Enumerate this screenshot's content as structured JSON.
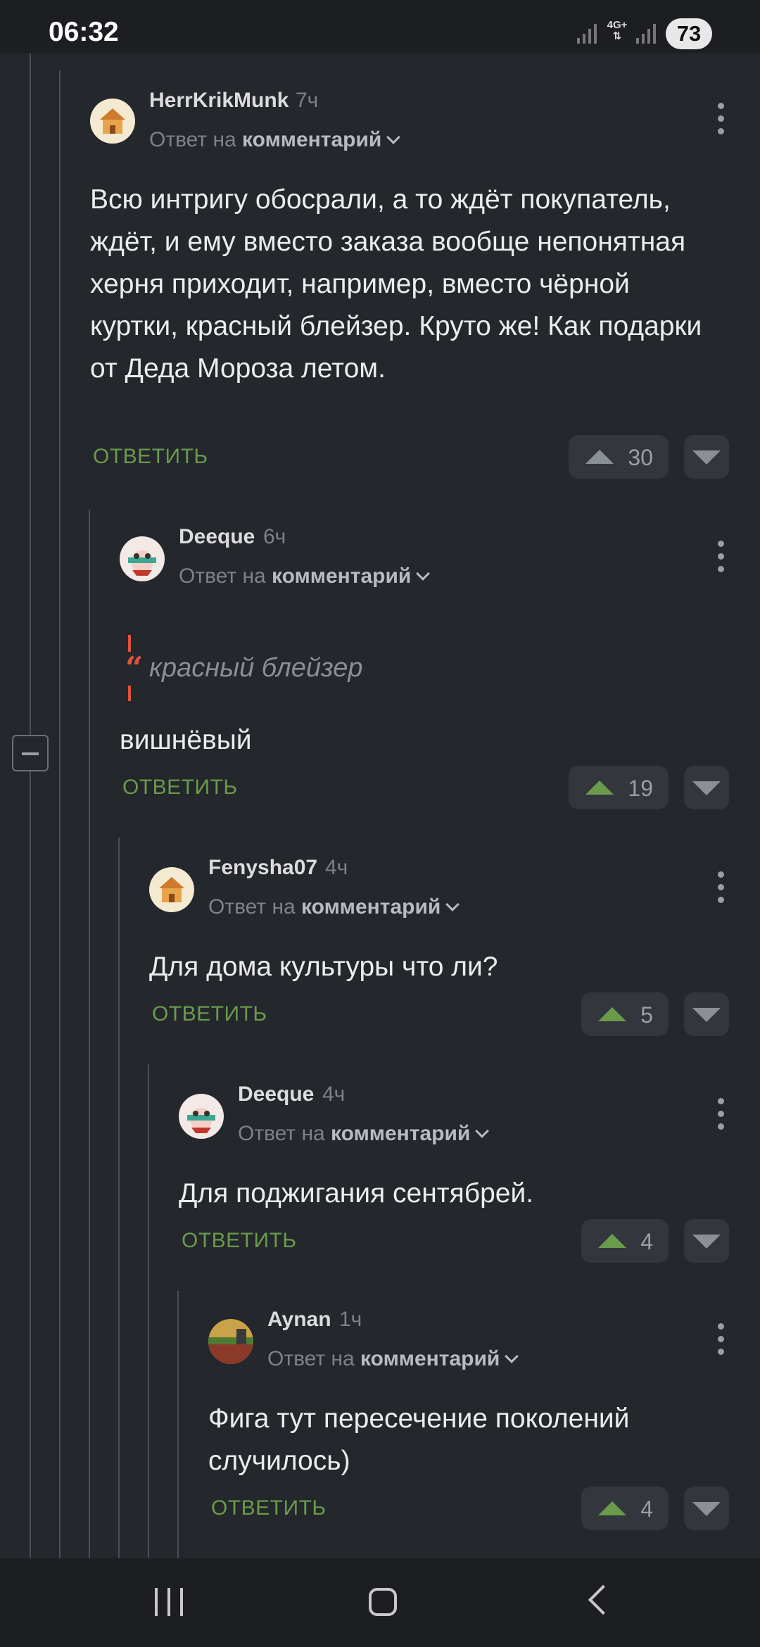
{
  "status_bar": {
    "time": "06:32",
    "network": "4G+",
    "battery": "73"
  },
  "comments": [
    {
      "author": "HerrKrikMunk",
      "age": "7ч",
      "reply_prefix": "Ответ на",
      "reply_target": "комментарий",
      "text": "Всю интригу обосрали, а то ждёт покупатель, ждёт, и ему вместо заказа вообще непонятная херня приходит, например, вместо чёрной куртки, красный блейзер. Круто же! Как подарки от Деда Мороза летом.",
      "reply_label": "ОТВЕТИТЬ",
      "votes": "30",
      "voted": false,
      "avatar": "house-avatar"
    },
    {
      "author": "Deeque",
      "age": "6ч",
      "reply_prefix": "Ответ на",
      "reply_target": "комментарий",
      "quote": "красный блейзер",
      "text": "вишнёвый",
      "reply_label": "ОТВЕТИТЬ",
      "votes": "19",
      "voted": true,
      "avatar": "character-avatar"
    },
    {
      "author": "Fenysha07",
      "age": "4ч",
      "reply_prefix": "Ответ на",
      "reply_target": "комментарий",
      "text": "Для дома культуры что ли?",
      "reply_label": "ОТВЕТИТЬ",
      "votes": "5",
      "voted": true,
      "avatar": "house-avatar"
    },
    {
      "author": "Deeque",
      "age": "4ч",
      "reply_prefix": "Ответ на",
      "reply_target": "комментарий",
      "text": "Для поджигания сентябрей.",
      "reply_label": "ОТВЕТИТЬ",
      "votes": "4",
      "voted": true,
      "avatar": "character-avatar"
    },
    {
      "author": "Aynan",
      "age": "1ч",
      "reply_prefix": "Ответ на",
      "reply_target": "комментарий",
      "text": "Фига тут пересечение поколений случилось)",
      "reply_label": "ОТВЕТИТЬ",
      "votes": "4",
      "voted": true,
      "avatar": "landscape-avatar"
    }
  ],
  "colors": {
    "background": "#24272c",
    "accent_green": "#6a9a4c",
    "quote_red": "#e0533d"
  }
}
